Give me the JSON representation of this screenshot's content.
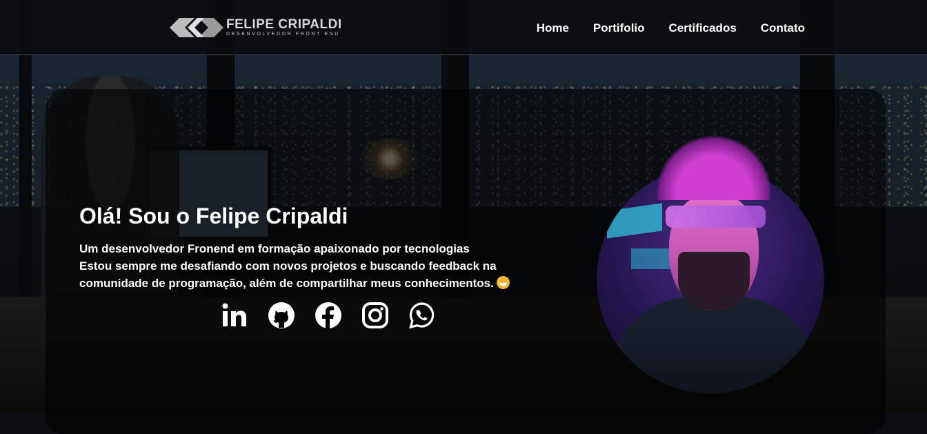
{
  "header": {
    "logo": {
      "name": "FELIPE CRIPALDI",
      "subtitle": "DESENVOLVEDOR FRONT END",
      "icon": "fc-logo-icon"
    },
    "nav": [
      {
        "label": "Home"
      },
      {
        "label": "Portifolio"
      },
      {
        "label": "Certificados"
      },
      {
        "label": "Contato"
      }
    ]
  },
  "hero": {
    "title": "Olá! Sou o Felipe Cripaldi",
    "lines": [
      "Um desenvolvedor Fronend em formação apaixonado por tecnologias",
      "Estou sempre me desafiando com novos projetos e buscando feedback na",
      "comunidade de programação, além de compartilhar meus conhecimentos."
    ],
    "emoji": "grinning-face-emoji",
    "socials": [
      {
        "icon": "linkedin-icon"
      },
      {
        "icon": "github-icon"
      },
      {
        "icon": "facebook-icon"
      },
      {
        "icon": "instagram-icon"
      },
      {
        "icon": "whatsapp-icon"
      }
    ],
    "avatar": "avatar-portrait"
  },
  "colors": {
    "text": "#ffffff",
    "header_bg": "#0a0c0f",
    "accent_avatar": "#c255b0"
  }
}
